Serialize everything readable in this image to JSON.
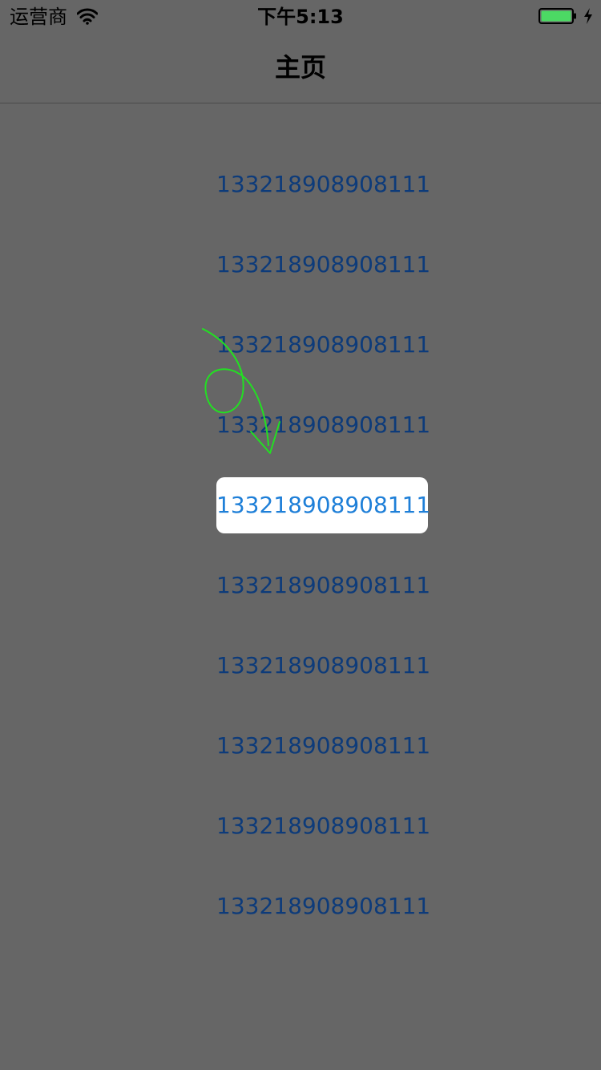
{
  "status_bar": {
    "carrier": "运营商",
    "time": "下午5:13",
    "icons": [
      "wifi-icon",
      "battery-icon",
      "charging-icon"
    ],
    "battery_color": "#4cd964"
  },
  "nav": {
    "title": "主页"
  },
  "list": {
    "items": [
      "133218908908111",
      "133218908908111",
      "133218908908111",
      "133218908908111",
      "133218908908111",
      "133218908908111",
      "133218908908111",
      "133218908908111",
      "133218908908111",
      "133218908908111"
    ],
    "selected_index": 4
  },
  "colors": {
    "background": "#666666",
    "item_text": "#0d3b7a",
    "selected_text": "#1e7fd8",
    "selected_bg": "#ffffff",
    "annotation": "#22e022"
  }
}
